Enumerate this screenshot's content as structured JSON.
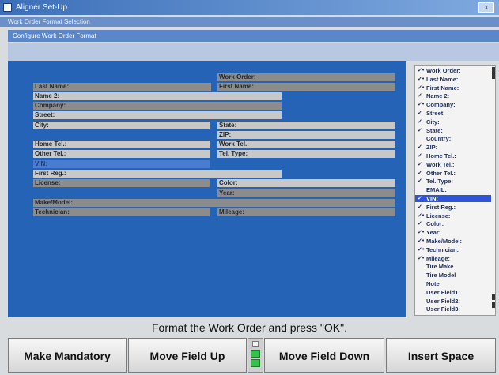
{
  "window": {
    "title": "Aligner Set-Up",
    "close_label": "x"
  },
  "breadcrumbs": {
    "level1": "Work Order Format Selection",
    "level2": "Configure Work Order Format"
  },
  "form_fields": [
    {
      "name": "field-work-order",
      "label": "Work Order:",
      "tone": "dark"
    },
    {
      "name": "field-last-name",
      "label": "Last Name:",
      "tone": "dark"
    },
    {
      "name": "field-first-name",
      "label": "First Name:",
      "tone": "dark"
    },
    {
      "name": "field-name-2",
      "label": "Name 2:",
      "tone": "light"
    },
    {
      "name": "field-company",
      "label": "Company:",
      "tone": "dark"
    },
    {
      "name": "field-street",
      "label": "Street:",
      "tone": "light"
    },
    {
      "name": "field-city",
      "label": "City:",
      "tone": "light"
    },
    {
      "name": "field-state",
      "label": "State:",
      "tone": "light"
    },
    {
      "name": "field-zip",
      "label": "ZIP:",
      "tone": "light"
    },
    {
      "name": "field-home-tel",
      "label": "Home Tel.:",
      "tone": "light"
    },
    {
      "name": "field-work-tel",
      "label": "Work Tel.:",
      "tone": "light"
    },
    {
      "name": "field-other-tel",
      "label": "Other Tel.:",
      "tone": "light"
    },
    {
      "name": "field-tel-type",
      "label": "Tel. Type:",
      "tone": "light"
    },
    {
      "name": "field-vin",
      "label": "VIN:",
      "tone": "blue"
    },
    {
      "name": "field-first-reg",
      "label": "First Reg.:",
      "tone": "light"
    },
    {
      "name": "field-license",
      "label": "License:",
      "tone": "dark"
    },
    {
      "name": "field-color",
      "label": "Color:",
      "tone": "light"
    },
    {
      "name": "field-year",
      "label": "Year:",
      "tone": "dark"
    },
    {
      "name": "field-make-model",
      "label": "Make/Model:",
      "tone": "dark"
    },
    {
      "name": "field-technician",
      "label": "Technician:",
      "tone": "dark"
    },
    {
      "name": "field-mileage",
      "label": "Mileage:",
      "tone": "dark"
    }
  ],
  "field_list": [
    {
      "label": "Work Order:",
      "check": "✓•"
    },
    {
      "label": "Last Name:",
      "check": "✓•"
    },
    {
      "label": "First Name:",
      "check": "✓•"
    },
    {
      "label": "Name 2:",
      "check": "✓"
    },
    {
      "label": "Company:",
      "check": "✓•"
    },
    {
      "label": "Street:",
      "check": "✓"
    },
    {
      "label": "City:",
      "check": "✓"
    },
    {
      "label": "State:",
      "check": "✓"
    },
    {
      "label": "Country:",
      "check": ""
    },
    {
      "label": "ZIP:",
      "check": "✓"
    },
    {
      "label": "Home Tel.:",
      "check": "✓"
    },
    {
      "label": "Work Tel.:",
      "check": "✓"
    },
    {
      "label": "Other Tel.:",
      "check": "✓"
    },
    {
      "label": "Tel. Type:",
      "check": "✓"
    },
    {
      "label": "EMAIL:",
      "check": ""
    },
    {
      "label": "VIN:",
      "check": "✓",
      "selected": true
    },
    {
      "label": "First Reg.:",
      "check": "✓"
    },
    {
      "label": "License:",
      "check": "✓•"
    },
    {
      "label": "Color:",
      "check": "✓"
    },
    {
      "label": "Year:",
      "check": "✓•"
    },
    {
      "label": "Make/Model:",
      "check": "✓•"
    },
    {
      "label": "Technician:",
      "check": "✓•"
    },
    {
      "label": "Mileage:",
      "check": "✓•"
    },
    {
      "label": "Tire Make",
      "check": ""
    },
    {
      "label": "Tire Model",
      "check": ""
    },
    {
      "label": "Note",
      "check": ""
    },
    {
      "label": "User Field1:",
      "check": ""
    },
    {
      "label": "User Field2:",
      "check": ""
    },
    {
      "label": "User Field3:",
      "check": ""
    }
  ],
  "instruction": "Format the Work Order and press \"OK\".",
  "buttons": {
    "make_mandatory": "Make Mandatory",
    "move_field_up": "Move Field Up",
    "move_field_down": "Move Field Down",
    "insert_space": "Insert Space"
  },
  "colors": {
    "panel_blue": "#2463b5",
    "field_light": "#c8c8c8",
    "field_dark": "#8c8c8c",
    "selected_row": "#2f55d4",
    "indicator_green": "#33c24a"
  }
}
